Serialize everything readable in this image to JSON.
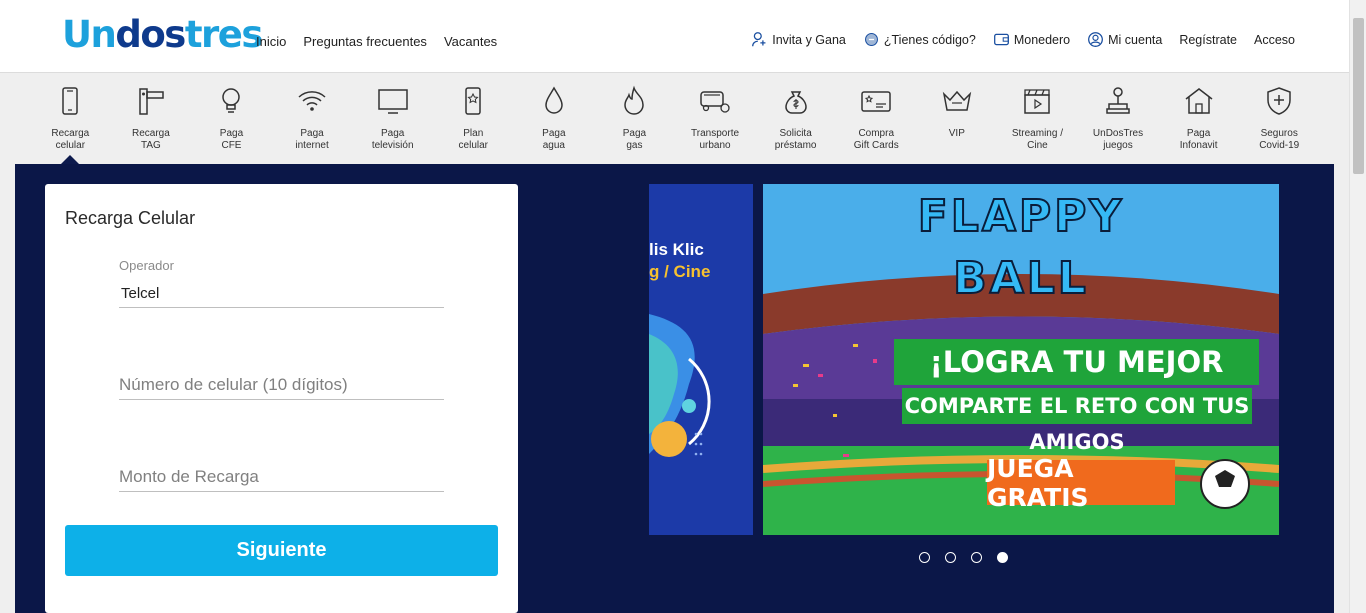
{
  "logo": {
    "part1": "Un",
    "part2": "dos",
    "part3": "tres"
  },
  "nav_left": [
    "Inicio",
    "Preguntas frecuentes",
    "Vacantes"
  ],
  "nav_right": [
    {
      "label": "Invita y Gana",
      "icon": "person-plus-icon"
    },
    {
      "label": "¿Tienes código?",
      "icon": "coupon-icon"
    },
    {
      "label": "Monedero",
      "icon": "wallet-icon"
    },
    {
      "label": "Mi cuenta",
      "icon": "account-icon"
    },
    {
      "label": "Regístrate",
      "icon": ""
    },
    {
      "label": "Acceso",
      "icon": ""
    }
  ],
  "services": [
    {
      "label": "Recarga\ncelular",
      "icon": "phone-icon",
      "active": true
    },
    {
      "label": "Recarga\nTAG",
      "icon": "toll-tag-icon"
    },
    {
      "label": "Paga\nCFE",
      "icon": "lightbulb-icon"
    },
    {
      "label": "Paga\ninternet",
      "icon": "wifi-icon"
    },
    {
      "label": "Paga\ntelevisión",
      "icon": "tv-icon"
    },
    {
      "label": "Plan\ncelular",
      "icon": "phone-plan-icon"
    },
    {
      "label": "Paga\nagua",
      "icon": "water-drop-icon"
    },
    {
      "label": "Paga\ngas",
      "icon": "flame-icon"
    },
    {
      "label": "Transporte\nurbano",
      "icon": "bus-icon"
    },
    {
      "label": "Solicita\npréstamo",
      "icon": "money-bag-icon"
    },
    {
      "label": "Compra\nGift Cards",
      "icon": "gift-card-icon"
    },
    {
      "label": "VIP",
      "icon": "crown-icon"
    },
    {
      "label": "Streaming /\nCine",
      "icon": "clapperboard-icon"
    },
    {
      "label": "UnDosTres\njuegos",
      "icon": "joystick-icon"
    },
    {
      "label": "Paga\nInfonavit",
      "icon": "house-icon"
    },
    {
      "label": "Seguros\nCovid-19",
      "icon": "shield-plus-icon"
    }
  ],
  "form": {
    "title": "Recarga Celular",
    "operator_label": "Operador",
    "operator_value": "Telcel",
    "phone_placeholder": "Número de celular (10 dígitos)",
    "amount_placeholder": "Monto de Recarga",
    "submit_label": "Siguiente"
  },
  "banner_prev": {
    "line1": "lis Klic",
    "line2": "g / Cine"
  },
  "banner": {
    "title1": "FLAPPY",
    "title2": "BALL",
    "headline": "¡LOGRA TU MEJOR PUNTAJE!",
    "subline": "COMPARTE EL RETO CON TUS AMIGOS",
    "cta": "JUEGA GRATIS"
  },
  "carousel": {
    "count": 4,
    "active_index": 3
  },
  "colors": {
    "brand_blue": "#1da1dc",
    "brand_navy": "#0e3a8c",
    "accent": "#0db0e8",
    "main_bg": "#0b1748"
  }
}
